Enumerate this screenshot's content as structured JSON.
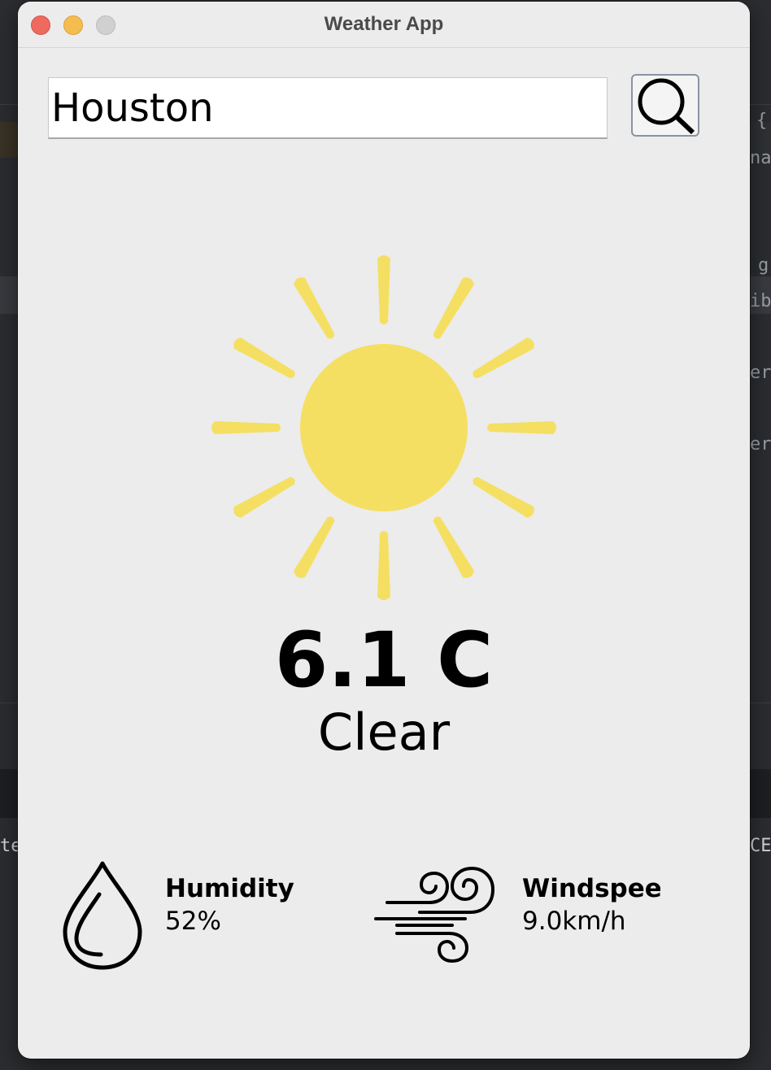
{
  "window": {
    "title": "Weather App"
  },
  "search": {
    "value": "Houston",
    "button_icon": "search-icon"
  },
  "weather": {
    "icon": "sun-icon",
    "icon_color": "#f4df62",
    "temperature": "6.1 C",
    "condition": "Clear"
  },
  "humidity": {
    "icon": "water-drop-icon",
    "label": "Humidity",
    "value": "52%"
  },
  "windspeed": {
    "icon": "wind-icon",
    "label": "Windspeed",
    "value": "9.0km/h"
  },
  "background_code": {
    "fragments": [
      "{",
      "na",
      "g",
      "ib",
      "er",
      "er",
      "te",
      "CE"
    ]
  }
}
